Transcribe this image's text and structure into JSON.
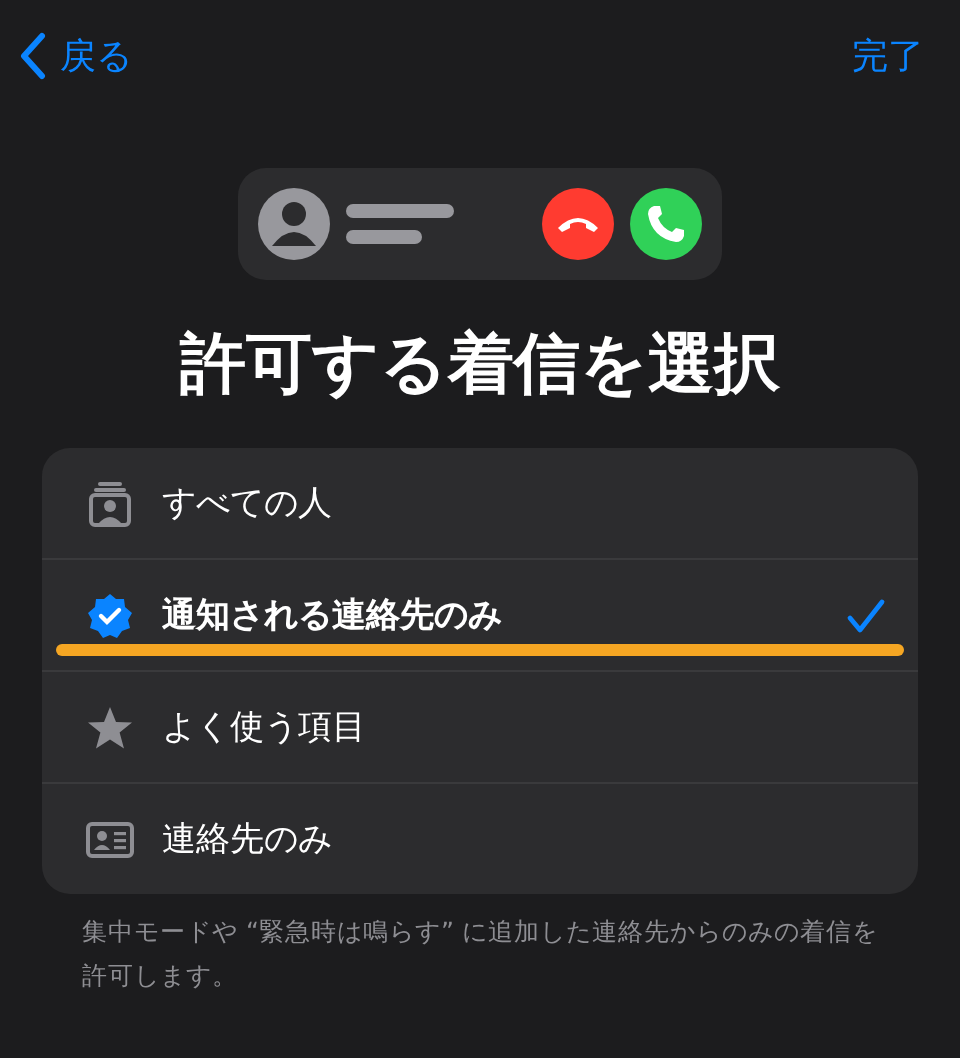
{
  "nav": {
    "back": "戻る",
    "done": "完了"
  },
  "title": "許可する着信を選択",
  "options": [
    {
      "kind": "people",
      "label": "すべての人",
      "selected": false,
      "highlighted": false
    },
    {
      "kind": "verified",
      "label": "通知される連絡先のみ",
      "selected": true,
      "highlighted": true
    },
    {
      "kind": "star",
      "label": "よく使う項目",
      "selected": false,
      "highlighted": false
    },
    {
      "kind": "card",
      "label": "連絡先のみ",
      "selected": false,
      "highlighted": false
    }
  ],
  "footnote": "集中モードや “緊急時は鳴らす” に追加した連絡先からのみの着信を許可します。"
}
